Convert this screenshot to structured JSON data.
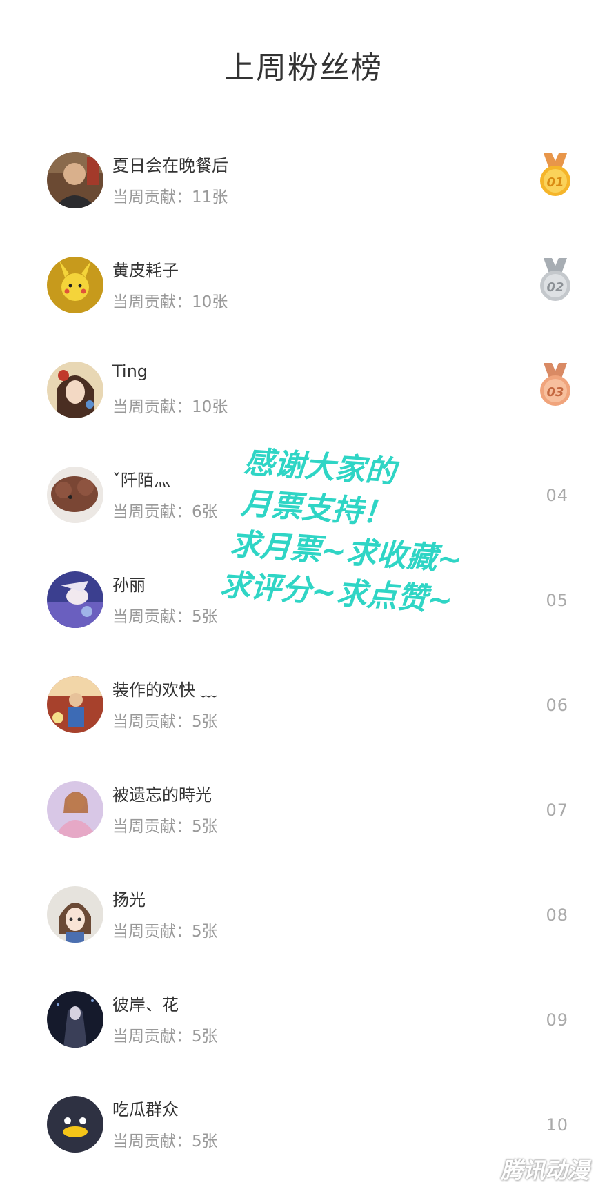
{
  "page": {
    "title": "上周粉丝榜"
  },
  "fans": [
    {
      "name": "夏日会在晚餐后",
      "contribution": "当周贡献：11张",
      "rank": "01",
      "medal": "gold"
    },
    {
      "name": "黄皮耗子",
      "contribution": "当周贡献：10张",
      "rank": "02",
      "medal": "silver"
    },
    {
      "name": "Ting",
      "contribution": "当周贡献：10张",
      "rank": "03",
      "medal": "bronze"
    },
    {
      "name": "ˇ阡陌灬",
      "contribution": "当周贡献：6张",
      "rank": "04"
    },
    {
      "name": "孙丽",
      "contribution": "当周贡献：5张",
      "rank": "05"
    },
    {
      "name": "装作的欢快 ﹏",
      "contribution": "当周贡献：5张",
      "rank": "06"
    },
    {
      "name": "被遗忘的時光",
      "contribution": "当周贡献：5张",
      "rank": "07"
    },
    {
      "name": "扬光",
      "contribution": "当周贡献：5张",
      "rank": "08"
    },
    {
      "name": "彼岸、花",
      "contribution": "当周贡献：5张",
      "rank": "09"
    },
    {
      "name": "吃瓜群众",
      "contribution": "当周贡献：5张",
      "rank": "10"
    }
  ],
  "promo": {
    "line1": "感谢大家的",
    "line2": "月票支持！",
    "line3": "求月票~求收藏~",
    "line4": "求评分~求点赞~"
  },
  "watermark": "腾讯动漫",
  "colors": {
    "gold": "#f5b52a",
    "silver": "#c4c8cc",
    "bronze": "#f0a47c",
    "promo_text": "#2fd5c5"
  }
}
